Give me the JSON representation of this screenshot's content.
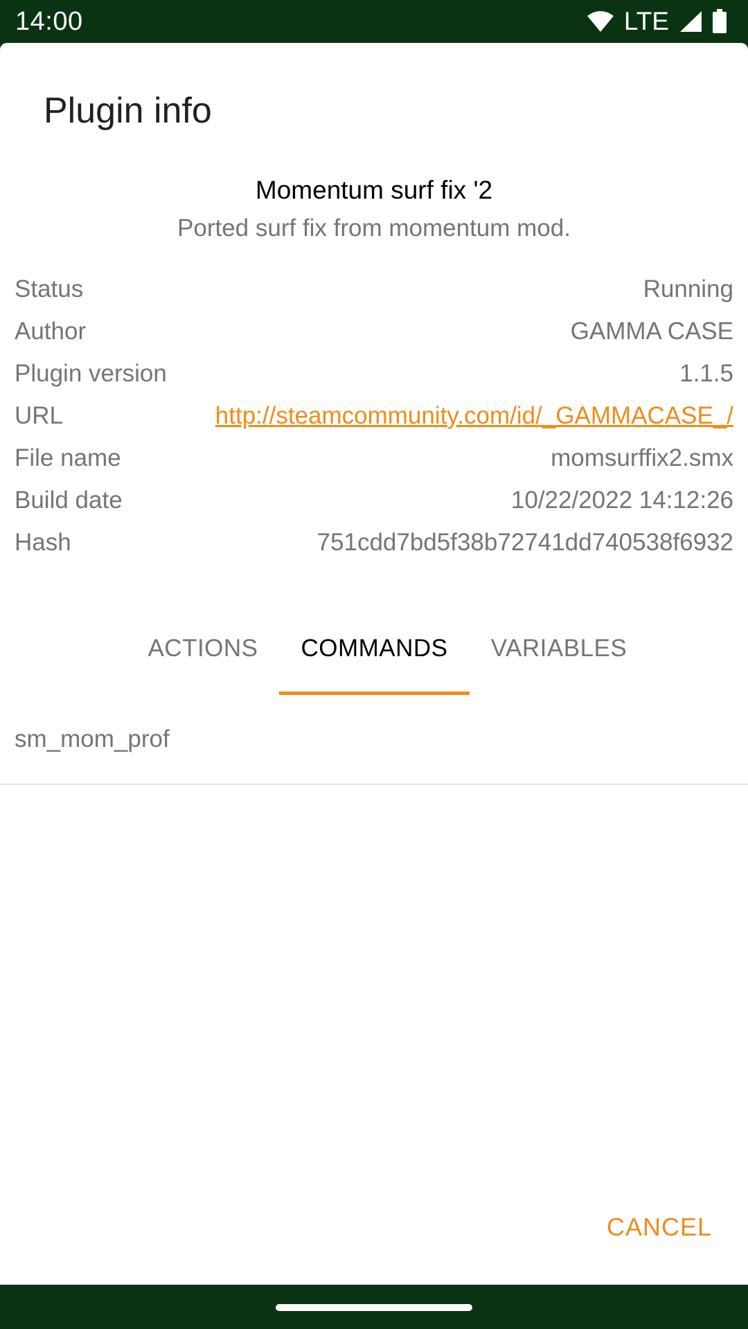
{
  "status_bar": {
    "time": "14:00",
    "network": "LTE",
    "icons": [
      "wifi-icon",
      "signal-icon",
      "battery-icon"
    ]
  },
  "dialog": {
    "title": "Plugin info",
    "plugin_name": "Momentum surf fix '2",
    "plugin_description": "Ported surf fix from momentum mod.",
    "info": [
      {
        "label": "Status",
        "value": "Running"
      },
      {
        "label": "Author",
        "value": "GAMMA CASE"
      },
      {
        "label": "Plugin version",
        "value": "1.1.5"
      },
      {
        "label": "URL",
        "value": "http://steamcommunity.com/id/_GAMMACASE_/"
      },
      {
        "label": "File name",
        "value": "momsurffix2.smx"
      },
      {
        "label": "Build date",
        "value": "10/22/2022 14:12:26"
      },
      {
        "label": "Hash",
        "value": "751cdd7bd5f38b72741dd740538f6932"
      }
    ],
    "tabs": [
      {
        "label": "ACTIONS",
        "active": false
      },
      {
        "label": "COMMANDS",
        "active": true
      },
      {
        "label": "VARIABLES",
        "active": false
      }
    ],
    "commands": [
      "sm_mom_prof"
    ],
    "cancel_label": "CANCEL"
  },
  "colors": {
    "accent": "#ef8c1a",
    "system_bar": "#0a3314",
    "secondary_text": "#757575"
  }
}
